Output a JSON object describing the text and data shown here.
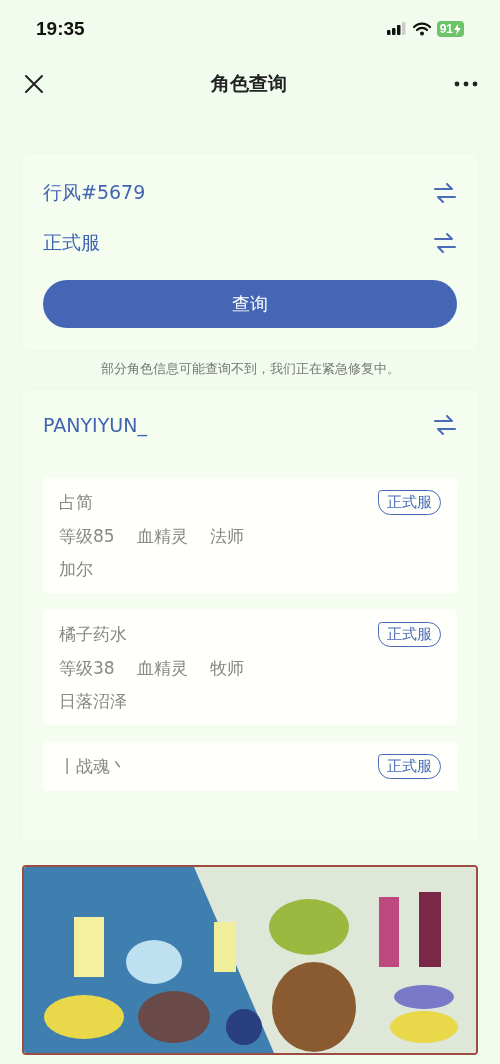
{
  "status_bar": {
    "time": "19:35",
    "battery": "91"
  },
  "nav": {
    "title": "角色查询"
  },
  "query": {
    "account": "行风#5679",
    "server": "正式服",
    "button": "查询"
  },
  "notice": "部分角色信息可能查询不到，我们正在紧急修复中。",
  "account": {
    "name": "PANYIYUN_"
  },
  "characters": [
    {
      "name": "占简",
      "level": "等级85",
      "race": "血精灵",
      "class": "法师",
      "realm": "加尔",
      "server": "正式服"
    },
    {
      "name": "橘子药水",
      "level": "等级38",
      "race": "血精灵",
      "class": "牧师",
      "realm": "日落沼泽",
      "server": "正式服"
    },
    {
      "name": "丨战魂丶",
      "server": "正式服"
    }
  ]
}
